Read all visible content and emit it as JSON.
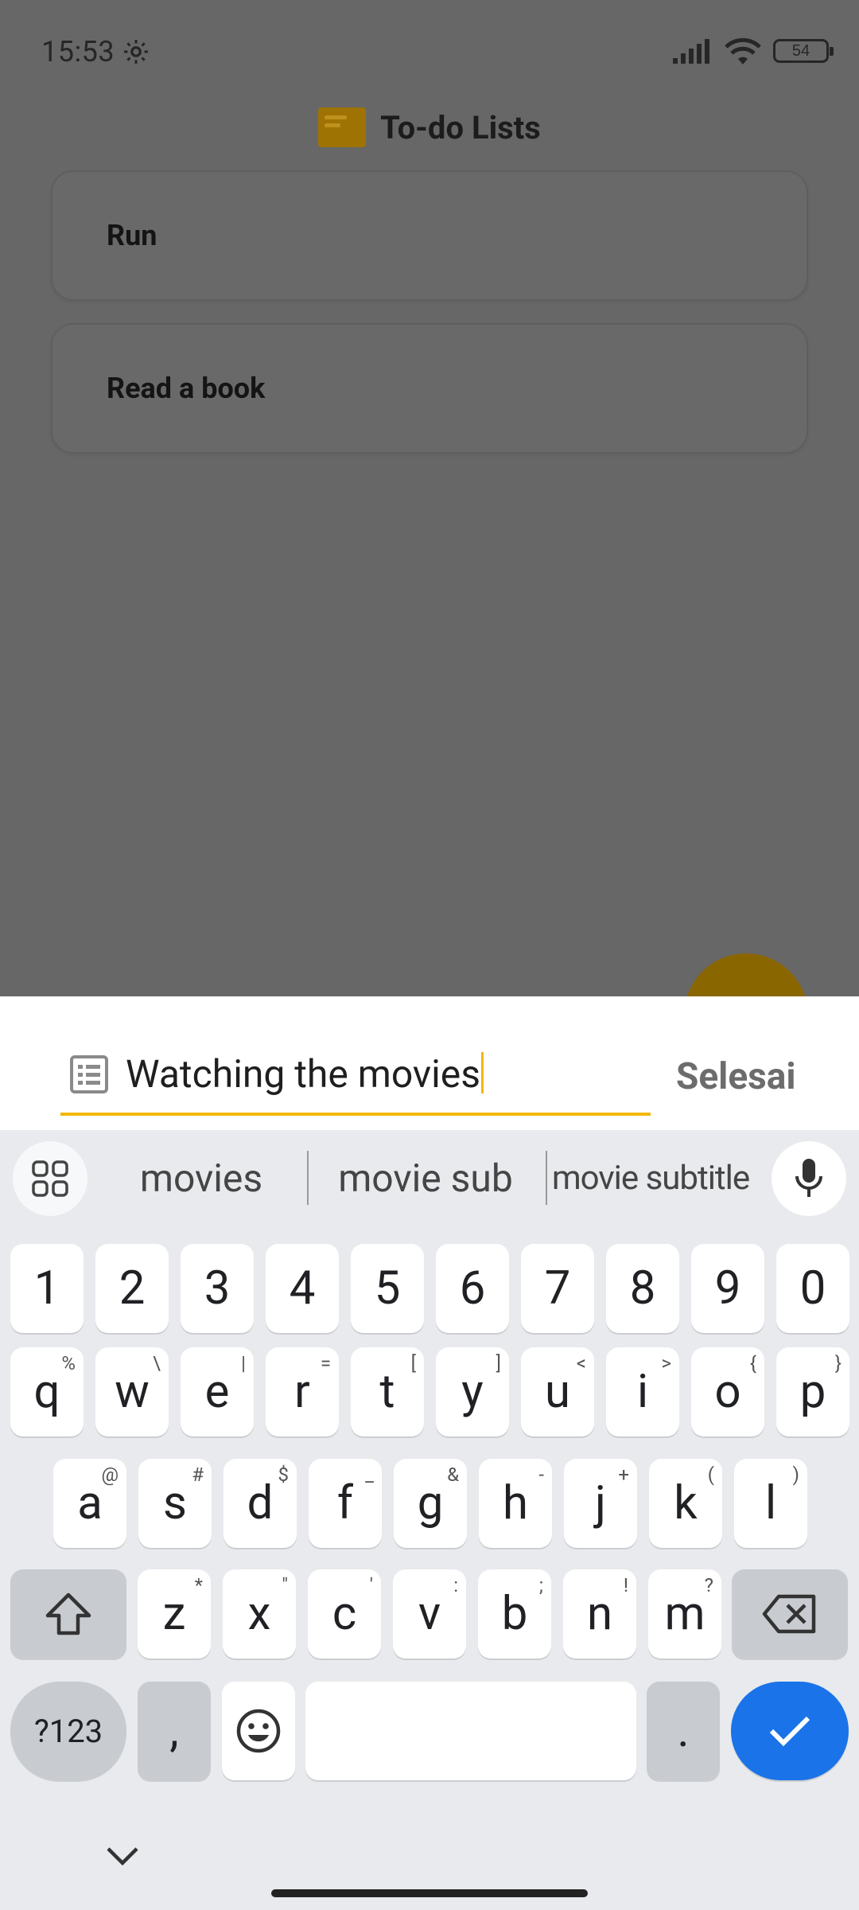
{
  "status": {
    "time": "15:53",
    "battery": "54"
  },
  "app": {
    "title": "To-do Lists"
  },
  "todos": [
    {
      "label": "Run"
    },
    {
      "label": "Read a book"
    }
  ],
  "editor": {
    "value": "Watching the movies",
    "done_label": "Selesai"
  },
  "keyboard": {
    "suggestions": [
      "movies",
      "movie sub",
      "movie subtitle"
    ],
    "numbers": [
      "1",
      "2",
      "3",
      "4",
      "5",
      "6",
      "7",
      "8",
      "9",
      "0"
    ],
    "row1": [
      {
        "k": "q",
        "h": "%"
      },
      {
        "k": "w",
        "h": "\\"
      },
      {
        "k": "e",
        "h": "|"
      },
      {
        "k": "r",
        "h": "="
      },
      {
        "k": "t",
        "h": "["
      },
      {
        "k": "y",
        "h": "]"
      },
      {
        "k": "u",
        "h": "<"
      },
      {
        "k": "i",
        "h": ">"
      },
      {
        "k": "o",
        "h": "{"
      },
      {
        "k": "p",
        "h": "}"
      }
    ],
    "row2": [
      {
        "k": "a",
        "h": "@"
      },
      {
        "k": "s",
        "h": "#"
      },
      {
        "k": "d",
        "h": "$"
      },
      {
        "k": "f",
        "h": "_"
      },
      {
        "k": "g",
        "h": "&"
      },
      {
        "k": "h",
        "h": "-"
      },
      {
        "k": "j",
        "h": "+"
      },
      {
        "k": "k",
        "h": "("
      },
      {
        "k": "l",
        "h": ")"
      }
    ],
    "row3": [
      {
        "k": "z",
        "h": "*"
      },
      {
        "k": "x",
        "h": "\""
      },
      {
        "k": "c",
        "h": "'"
      },
      {
        "k": "v",
        "h": ":"
      },
      {
        "k": "b",
        "h": ";"
      },
      {
        "k": "n",
        "h": "!"
      },
      {
        "k": "m",
        "h": "?"
      }
    ],
    "symbols_label": "?123",
    "comma": ",",
    "period": "."
  },
  "colors": {
    "accent": "#f2b705",
    "enter": "#1a73e8"
  }
}
